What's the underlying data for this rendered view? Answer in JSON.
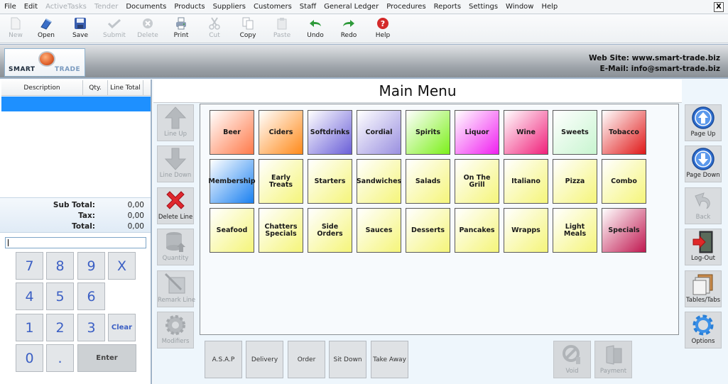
{
  "menubar": {
    "items": [
      {
        "label": "File",
        "enabled": true
      },
      {
        "label": "Edit",
        "enabled": true
      },
      {
        "label": "ActiveTasks",
        "enabled": false
      },
      {
        "label": "Tender",
        "enabled": false
      },
      {
        "label": "Documents",
        "enabled": true
      },
      {
        "label": "Products",
        "enabled": true
      },
      {
        "label": "Suppliers",
        "enabled": true
      },
      {
        "label": "Customers",
        "enabled": true
      },
      {
        "label": "Staff",
        "enabled": true
      },
      {
        "label": "General Ledger",
        "enabled": true
      },
      {
        "label": "Procedures",
        "enabled": true
      },
      {
        "label": "Reports",
        "enabled": true
      },
      {
        "label": "Settings",
        "enabled": true
      },
      {
        "label": "Window",
        "enabled": true
      },
      {
        "label": "Help",
        "enabled": true
      }
    ],
    "close_label": "X"
  },
  "toolbar": {
    "new": "New",
    "open": "Open",
    "save": "Save",
    "submit": "Submit",
    "delete": "Delete",
    "print": "Print",
    "cut": "Cut",
    "copy": "Copy",
    "paste": "Paste",
    "undo": "Undo",
    "redo": "Redo",
    "help": "Help"
  },
  "banner": {
    "logo_left": "SMART",
    "logo_right": "TRADE",
    "website": "Web Site: www.smart-trade.biz",
    "email": "E-Mail: info@smart-trade.biz"
  },
  "order": {
    "columns": [
      "Description",
      "Qty.",
      "Line Total"
    ],
    "subtotal_label": "Sub Total:",
    "subtotal": "0,00",
    "tax_label": "Tax:",
    "tax": "0,00",
    "total_label": "Total:",
    "total": "0,00",
    "input_value": ""
  },
  "keypad": {
    "k7": "7",
    "k8": "8",
    "k9": "9",
    "kx": "X",
    "k4": "4",
    "k5": "5",
    "k6": "6",
    "k1": "1",
    "k2": "2",
    "k3": "3",
    "clear": "Clear",
    "k0": "0",
    "dot": ".",
    "enter": "Enter"
  },
  "main": {
    "title": "Main Menu",
    "left_actions": {
      "line_up": "Line Up",
      "line_down": "Line Down",
      "delete_line": "Delete Line",
      "quantity": "Quantity",
      "remark_line": "Remark Line",
      "modifiers": "Modifiers"
    },
    "right_actions": {
      "page_up": "Page Up",
      "page_down": "Page Down",
      "back": "Back",
      "logout": "Log-Out",
      "tables": "Tables/Tabs",
      "options": "Options"
    },
    "categories": [
      {
        "label": "Beer",
        "color": "#ff7a4a"
      },
      {
        "label": "Ciders",
        "color": "#ff8a1a"
      },
      {
        "label": "Softdrinks",
        "color": "#6a5fd8"
      },
      {
        "label": "Cordial",
        "color": "#9a90e0"
      },
      {
        "label": "Spirits",
        "color": "#7cf01a"
      },
      {
        "label": "Liquor",
        "color": "#f020f0"
      },
      {
        "label": "Wine",
        "color": "#f0207a"
      },
      {
        "label": "Sweets",
        "color": "#c8f5d0"
      },
      {
        "label": "Tobacco",
        "color": "#e01818"
      },
      {
        "label": "Membership",
        "color": "#1a80f0"
      },
      {
        "label": "Early Treats",
        "color": "#f5f57a"
      },
      {
        "label": "Starters",
        "color": "#f5f57a"
      },
      {
        "label": "Sandwiches",
        "color": "#f5f57a"
      },
      {
        "label": "Salads",
        "color": "#f5f57a"
      },
      {
        "label": "On The Grill",
        "color": "#f5f57a"
      },
      {
        "label": "Italiano",
        "color": "#f5f57a"
      },
      {
        "label": "Pizza",
        "color": "#f5f57a"
      },
      {
        "label": "Combo",
        "color": "#f5f57a"
      },
      {
        "label": "Seafood",
        "color": "#f5f57a"
      },
      {
        "label": "Chatters Specials",
        "color": "#f5f57a"
      },
      {
        "label": "Side Orders",
        "color": "#f5f57a"
      },
      {
        "label": "Sauces",
        "color": "#f5f57a"
      },
      {
        "label": "Desserts",
        "color": "#f5f57a"
      },
      {
        "label": "Pancakes",
        "color": "#f5f57a"
      },
      {
        "label": "Wrapps",
        "color": "#f5f57a"
      },
      {
        "label": "Light Meals",
        "color": "#f5f57a"
      },
      {
        "label": "Specials",
        "color": "#c01850"
      }
    ],
    "order_types": [
      "A.S.A.P",
      "Delivery",
      "Order",
      "Sit Down",
      "Take Away"
    ],
    "void": "Void",
    "payment": "Payment"
  }
}
